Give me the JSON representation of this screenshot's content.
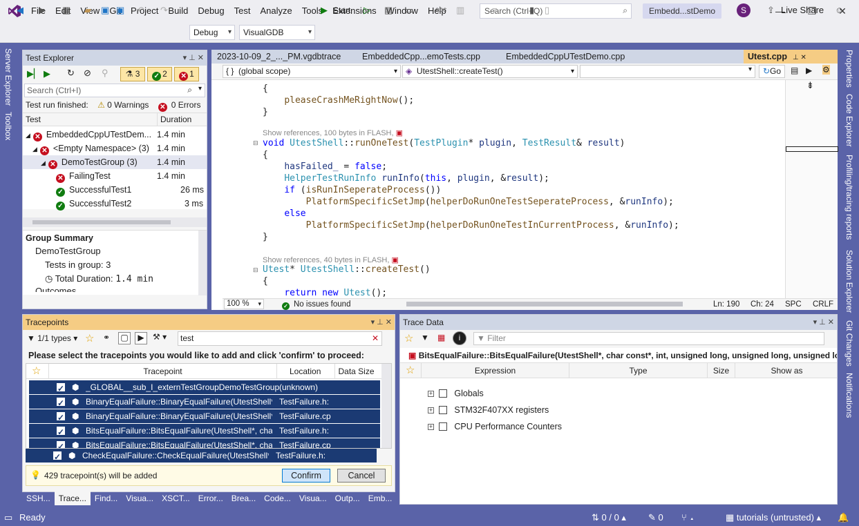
{
  "menu": [
    "File",
    "Edit",
    "View",
    "Git",
    "Project",
    "Build",
    "Debug",
    "Test",
    "Analyze",
    "Tools",
    "Extensions",
    "Window",
    "Help"
  ],
  "search": {
    "placeholder": "Search (Ctrl+Q)"
  },
  "window_title": "Embedd...stDemo",
  "avatar_letter": "S",
  "toolbar": {
    "config": "Debug",
    "platform": "VisualGDB",
    "start": "Start",
    "live_share": "Live Share"
  },
  "left_sidebar": [
    "Server Explorer",
    "Toolbox"
  ],
  "right_sidebar": [
    "Properties",
    "Code Explorer",
    "Profiling/tracing reports",
    "Solution Explorer",
    "Git Changes",
    "Notifications"
  ],
  "test_explorer": {
    "title": "Test Explorer",
    "counts": {
      "total": "3",
      "passed": "2",
      "failed": "1"
    },
    "search_placeholder": "Search (Ctrl+I)",
    "status": "Test run finished:",
    "warnings": "0 Warnings",
    "errors": "0 Errors",
    "columns": {
      "test": "Test",
      "duration": "Duration"
    },
    "rows": [
      {
        "name": "EmbeddedCppUTestDem...",
        "duration": "1.4 min",
        "status": "fail"
      },
      {
        "name": "<Empty Namespace> (3)",
        "duration": "1.4 min",
        "status": "fail"
      },
      {
        "name": "DemoTestGroup (3)",
        "duration": "1.4 min",
        "status": "fail"
      },
      {
        "name": "FailingTest",
        "duration": "1.4 min",
        "status": "fail"
      },
      {
        "name": "SuccessfulTest1",
        "duration": "26 ms",
        "status": "pass"
      },
      {
        "name": "SuccessfulTest2",
        "duration": "3 ms",
        "status": "pass"
      }
    ],
    "summary": {
      "title": "Group Summary",
      "group": "DemoTestGroup",
      "tests_label": "Tests in group:",
      "tests_value": "3",
      "duration_label": "Total Duration:",
      "duration_value": "1.4 min",
      "outcomes": "Outcomes"
    }
  },
  "editor": {
    "tabs": [
      "2023-10-09_2_..._PM.vgdbtrace",
      "EmbeddedCpp...emoTests.cpp",
      "EmbeddedCppUTestDemo.cpp",
      "Utest.cpp"
    ],
    "scope": "(global scope)",
    "function": "UtestShell::createTest()",
    "go": "Go",
    "hint1": "Show references, 100 bytes in FLASH,",
    "hint2": "Show references, 40 bytes in FLASH,",
    "zoom": "100 %",
    "issues": "No issues found",
    "ln": "Ln: 190",
    "ch": "Ch: 24",
    "spc": "SPC",
    "crlf": "CRLF"
  },
  "tracepoints": {
    "title": "Tracepoints",
    "types": "1/1 types",
    "filter": "test",
    "instruction": "Please select the tracepoints you would like to add and click 'confirm' to proceed:",
    "columns": {
      "tracepoint": "Tracepoint",
      "location": "Location",
      "datasize": "Data Size"
    },
    "rows": [
      {
        "name": "_GLOBAL__sub_I_externTestGroupDemoTestGroup",
        "location": "(unknown)"
      },
      {
        "name": "BinaryEqualFailure::BinaryEqualFailure(UtestShell*,",
        "location": "TestFailure.h:"
      },
      {
        "name": "BinaryEqualFailure::BinaryEqualFailure(UtestShell*,",
        "location": "TestFailure.cp"
      },
      {
        "name": "BitsEqualFailure::BitsEqualFailure(UtestShell*, char (",
        "location": "TestFailure.h:"
      },
      {
        "name": "BitsEqualFailure::BitsEqualFailure(UtestShell*, char (",
        "location": "TestFailure.cp"
      },
      {
        "name": "CheckEqualFailure::CheckEqualFailure(UtestShell*,",
        "location": "TestFailure.h:"
      }
    ],
    "count": "429 tracepoint(s) will be added",
    "confirm": "Confirm",
    "cancel": "Cancel"
  },
  "bottom_tabs": [
    "SSH...",
    "Trace...",
    "Find...",
    "Visua...",
    "XSCT...",
    "Error...",
    "Brea...",
    "Code...",
    "Visua...",
    "Outp...",
    "Emb..."
  ],
  "trace_data": {
    "title": "Trace Data",
    "filter_placeholder": "Filter",
    "event": "BitsEqualFailure::BitsEqualFailure(UtestShell*, char const*, int, unsigned long, unsigned long, unsigned long, u",
    "columns": {
      "expression": "Expression",
      "type": "Type",
      "size": "Size",
      "show_as": "Show as"
    },
    "rows": [
      "Globals",
      "STM32F407XX registers",
      "CPU Performance Counters"
    ]
  },
  "status": {
    "ready": "Ready",
    "changes": "0 / 0",
    "edits": "0",
    "repo": "tutorials (untrusted)"
  },
  "colors": {
    "accent": "#5a63a8",
    "selection": "#1b3a73",
    "fail": "#c50f1f",
    "pass": "#107c10",
    "tracepoint_header": "#f5cc84"
  }
}
